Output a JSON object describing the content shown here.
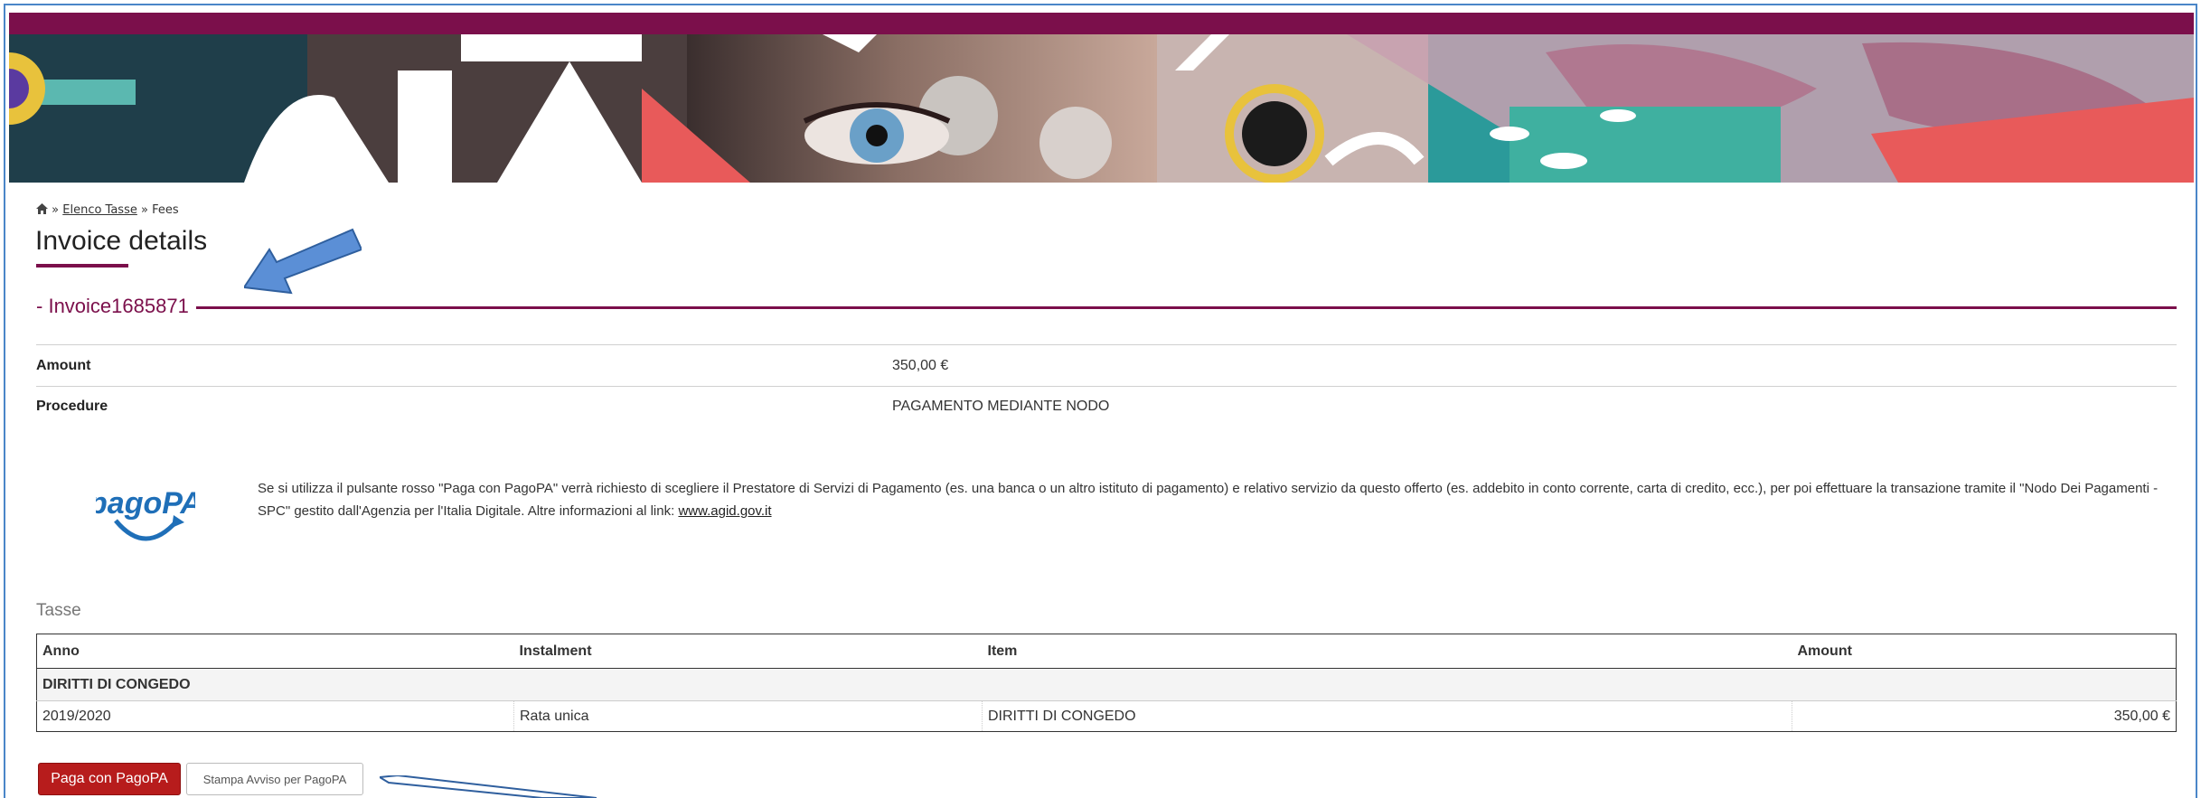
{
  "breadcrumb": {
    "separator1": "»",
    "link": "Elenco Tasse",
    "separator2": "»",
    "current": "Fees"
  },
  "page": {
    "title": "Invoice details",
    "invoice_label": "Invoice1685871"
  },
  "details": {
    "amount_label": "Amount",
    "amount_value": "350,00 €",
    "procedure_label": "Procedure",
    "procedure_value": "PAGAMENTO MEDIANTE NODO"
  },
  "pagopa": {
    "logo_text": "pagoPA",
    "info_text": "Se si utilizza il pulsante rosso \"Paga con PagoPA\" verrà richiesto di scegliere il Prestatore di Servizi di Pagamento (es. una banca o un altro istituto di pagamento) e relativo servizio da questo offerto (es. addebito in conto corrente, carta di credito, ecc.), per poi effettuare la transazione tramite il \"Nodo Dei Pagamenti - SPC\" gestito dall'Agenzia per l'Italia Digitale. Altre informazioni al link: ",
    "link_text": "www.agid.gov.it"
  },
  "fees": {
    "section_label": "Tasse",
    "columns": [
      "Anno",
      "Instalment",
      "Item",
      "Amount"
    ],
    "group_label": "DIRITTI DI CONGEDO",
    "rows": [
      [
        "2019/2020",
        "Rata unica",
        "DIRITTI DI CONGEDO",
        "350,00 €"
      ]
    ]
  },
  "actions": {
    "pay_label": "Paga con PagoPA",
    "print_label": "Stampa Avviso per PagoPA"
  },
  "colors": {
    "brand": "#7b0f4b",
    "pay_button": "#b71c1c",
    "annotation_arrow": "#5b8fd6"
  }
}
